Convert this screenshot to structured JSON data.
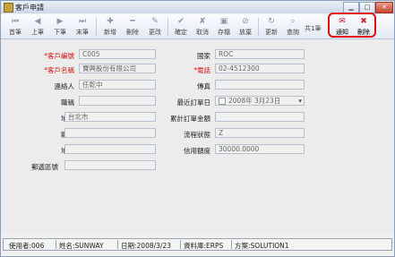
{
  "window": {
    "title": "客戶申請"
  },
  "toolbar": {
    "first": "首筆",
    "prev": "上筆",
    "next": "下筆",
    "last": "末筆",
    "add": "新增",
    "delete": "刪除",
    "edit": "更改",
    "confirm": "確定",
    "cancel": "取消",
    "save": "存檔",
    "discard": "放棄",
    "refresh": "更新",
    "query": "查詢",
    "record_count": "共1筆",
    "notify": "通知",
    "remove": "刪除"
  },
  "form": {
    "customer_id": {
      "label": "*客戶編號",
      "value": "C005"
    },
    "customer_name": {
      "label": "*客戶名稱",
      "value": "寶興股份有限公司"
    },
    "contact": {
      "label": "連絡人",
      "value": "任乾中"
    },
    "title": {
      "label": "職稱",
      "value": ""
    },
    "address": {
      "label": "地址",
      "value": "台北市"
    },
    "county": {
      "label": "縣市",
      "value": ""
    },
    "region": {
      "label": "地區",
      "value": ""
    },
    "postal_code": {
      "label": "郵遞區號",
      "value": ""
    },
    "country": {
      "label": "國家",
      "value": "ROC"
    },
    "phone": {
      "label": "*電話",
      "value": "02-4512300"
    },
    "fax": {
      "label": "傳真",
      "value": ""
    },
    "last_order_date": {
      "label": "最近訂單日",
      "value": "2008年 3月23日"
    },
    "total_order_amount": {
      "label": "累計訂單金額",
      "value": ""
    },
    "process_status": {
      "label": "流程狀態",
      "value": "Z"
    },
    "credit_limit": {
      "label": "信用額度",
      "value": "30000.0000"
    }
  },
  "statusbar": {
    "user": "使用者:006",
    "name": "姓名:SUNWAY",
    "date": "日期:2008/3/23",
    "database": "資料庫:ERPS",
    "solution": "方案:SOLUTION1"
  }
}
